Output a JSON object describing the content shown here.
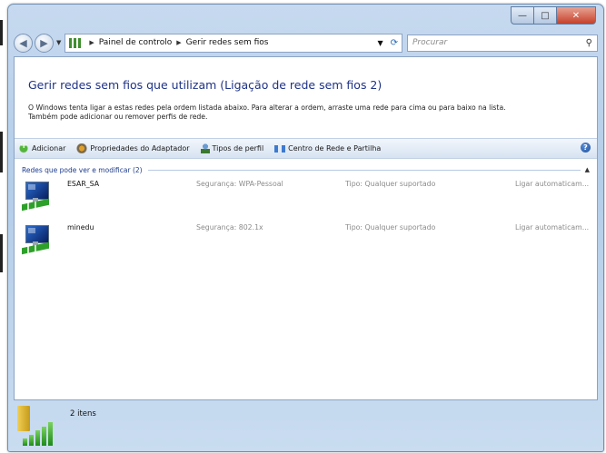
{
  "address_bar": {
    "crumbs": [
      "Painel de controlo",
      "Gerir redes sem fios"
    ],
    "search_placeholder": "Procurar"
  },
  "page": {
    "title": "Gerir redes sem fios que utilizam (Ligação de rede sem fios 2)",
    "description_line1": "O Windows tenta ligar a estas redes pela ordem listada abaixo. Para alterar a ordem, arraste uma rede para cima ou para baixo na lista.",
    "description_line2": "Também pode adicionar ou remover perfis de rede."
  },
  "toolbar": {
    "add": "Adicionar",
    "adapter_properties": "Propriedades do Adaptador",
    "profile_types": "Tipos de perfil",
    "network_center": "Centro de Rede e Partilha"
  },
  "group": {
    "label": "Redes que pode ver e modificar (2)"
  },
  "networks": [
    {
      "name": "ESAR_SA",
      "security": "Segurança: WPA-Pessoal",
      "type": "Tipo: Qualquer suportado",
      "connect": "Ligar automaticam..."
    },
    {
      "name": "minedu",
      "security": "Segurança: 802.1x",
      "type": "Tipo: Qualquer suportado",
      "connect": "Ligar automaticam..."
    }
  ],
  "details": {
    "count": "2 itens"
  },
  "icons": {
    "back": "back-arrow-icon",
    "forward": "forward-arrow-icon",
    "address": "network-folder-icon",
    "refresh": "refresh-icon",
    "search": "magnifier-icon",
    "help": "help-icon"
  }
}
